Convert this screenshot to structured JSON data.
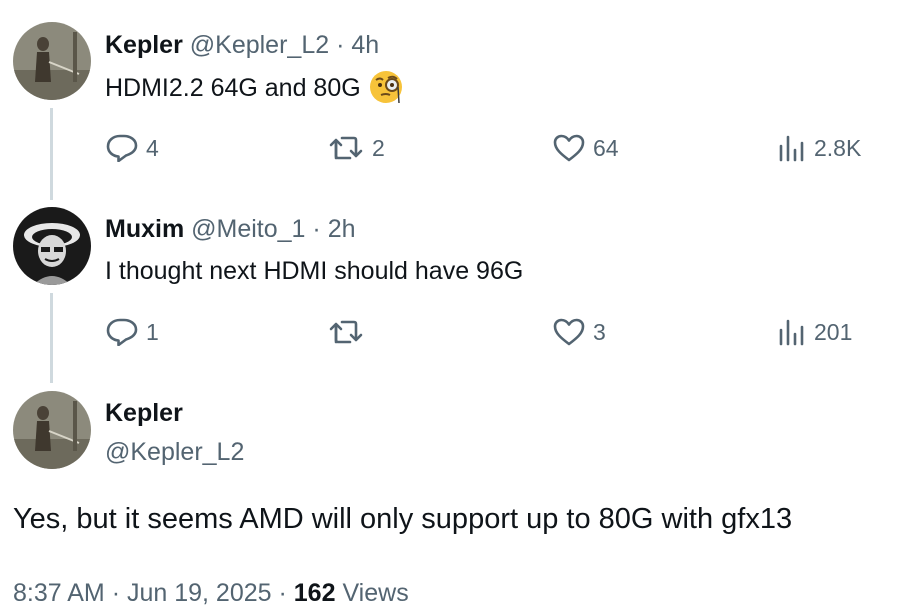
{
  "reply1": {
    "name": "Kepler",
    "handle": "@Kepler_L2",
    "separator": "·",
    "time": "4h",
    "text": "HDMI2.2 64G and 80G",
    "emoji": "monocle-face-emoji",
    "actions": {
      "replies": "4",
      "retweets": "2",
      "likes": "64",
      "views": "2.8K"
    }
  },
  "reply2": {
    "name": "Muxim",
    "handle": "@Meito_1",
    "separator": "·",
    "time": "2h",
    "text": "I thought next HDMI should have 96G",
    "actions": {
      "replies": "1",
      "retweets": "",
      "likes": "3",
      "views": "201"
    }
  },
  "main": {
    "name": "Kepler",
    "handle": "@Kepler_L2",
    "text": "Yes, but it seems AMD will only support up to 80G with gfx13",
    "time": "8:37 AM",
    "separator": "·",
    "date": "Jun 19, 2025",
    "separator2": "·",
    "views_count": "162",
    "views_label": "Views"
  },
  "colors": {
    "text": "#0f1419",
    "secondary": "#536471",
    "thread_line": "#cfd9de"
  }
}
